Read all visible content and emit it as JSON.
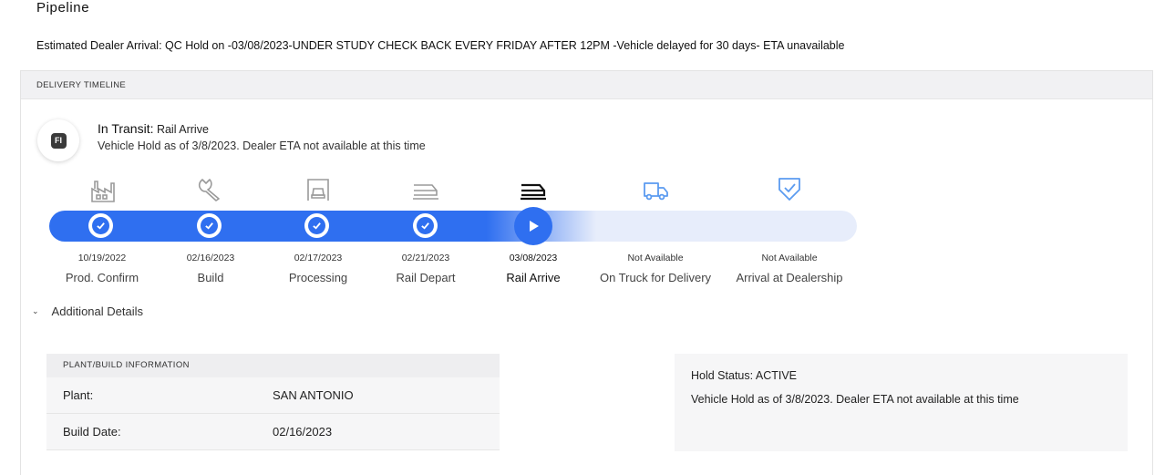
{
  "page": {
    "title": "Pipeline",
    "eta_banner": "Estimated Dealer Arrival: QC Hold on -03/08/2023-UNDER STUDY CHECK BACK EVERY FRIDAY AFTER 12PM -Vehicle delayed for 30 days- ETA unavailable"
  },
  "timeline": {
    "header": "DELIVERY TIMELINE",
    "badge": "FI",
    "status_label": "In Transit:",
    "status_value": "Rail Arrive",
    "status_sub": "Vehicle Hold as of 3/8/2023. Dealer ETA not available at this time",
    "progress_completed_steps": 4,
    "current_step_index": 4,
    "colors": {
      "accent": "#2f6ff0",
      "icon_done": "#9a9a9a",
      "icon_current": "#111111",
      "icon_future": "#5b9bf0"
    },
    "steps": [
      {
        "date": "10/19/2022",
        "label": "Prod. Confirm",
        "icon": "factory-icon",
        "state": "done"
      },
      {
        "date": "02/16/2023",
        "label": "Build",
        "icon": "wrench-icon",
        "state": "done"
      },
      {
        "date": "02/17/2023",
        "label": "Processing",
        "icon": "car-inspection-icon",
        "state": "done"
      },
      {
        "date": "02/21/2023",
        "label": "Rail Depart",
        "icon": "rail-depart-icon",
        "state": "done"
      },
      {
        "date": "03/08/2023",
        "label": "Rail Arrive",
        "icon": "rail-arrive-icon",
        "state": "current"
      },
      {
        "date": "Not Available",
        "label": "On Truck for Delivery",
        "icon": "truck-icon",
        "state": "future"
      },
      {
        "date": "Not Available",
        "label": "Arrival at Dealership",
        "icon": "shield-check-icon",
        "state": "future"
      }
    ]
  },
  "additional_details": {
    "toggle_label": "Additional Details",
    "plant": {
      "header": "PLANT/BUILD INFORMATION",
      "rows": [
        {
          "key": "Plant:",
          "value": "SAN ANTONIO"
        },
        {
          "key": "Build Date:",
          "value": "02/16/2023"
        }
      ]
    },
    "hold": {
      "status": "Hold Status: ACTIVE",
      "message": "Vehicle Hold as of 3/8/2023. Dealer ETA not available at this time"
    }
  }
}
